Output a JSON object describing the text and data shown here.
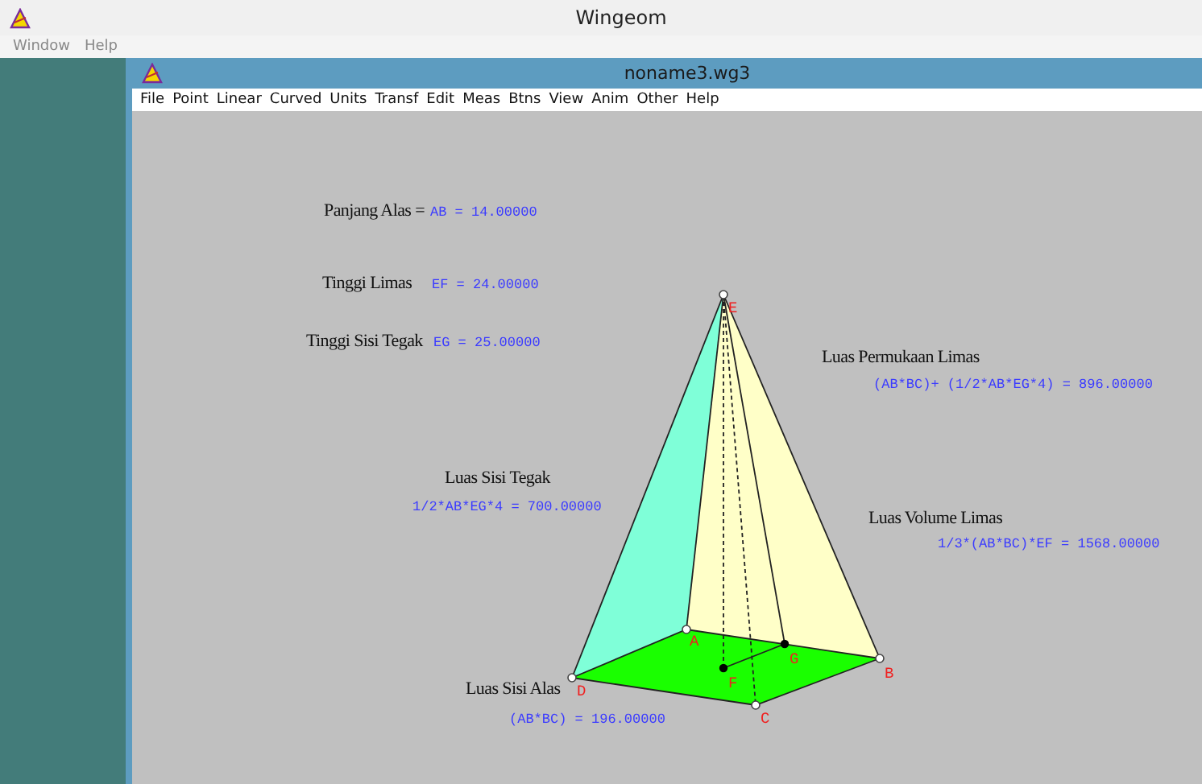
{
  "window": {
    "title": "Wingeom",
    "menu": [
      "Window",
      "Help"
    ]
  },
  "document": {
    "title": "noname3.wg3",
    "menu": [
      "File",
      "Point",
      "Linear",
      "Curved",
      "Units",
      "Transf",
      "Edit",
      "Meas",
      "Btns",
      "View",
      "Anim",
      "Other",
      "Help"
    ]
  },
  "measurements": [
    {
      "label": "Panjang Alas =",
      "value": "AB = 14.00000"
    },
    {
      "label": "Tinggi Limas",
      "value": "EF = 24.00000"
    },
    {
      "label": "Tinggi Sisi Tegak",
      "value": "EG = 25.00000"
    },
    {
      "label": "Luas Permukaan Limas",
      "value": "(AB*BC)+ (1/2*AB*EG*4) = 896.00000"
    },
    {
      "label": "Luas Sisi Tegak",
      "value": "1/2*AB*EG*4 = 700.00000"
    },
    {
      "label": "Luas Volume Limas",
      "value": "1/3*(AB*BC)*EF = 1568.00000"
    },
    {
      "label": "Luas Sisi Alas",
      "value": "(AB*BC) = 196.00000"
    }
  ],
  "points": [
    {
      "name": "E"
    },
    {
      "name": "A"
    },
    {
      "name": "B"
    },
    {
      "name": "C"
    },
    {
      "name": "D"
    },
    {
      "name": "F"
    },
    {
      "name": "G"
    }
  ]
}
